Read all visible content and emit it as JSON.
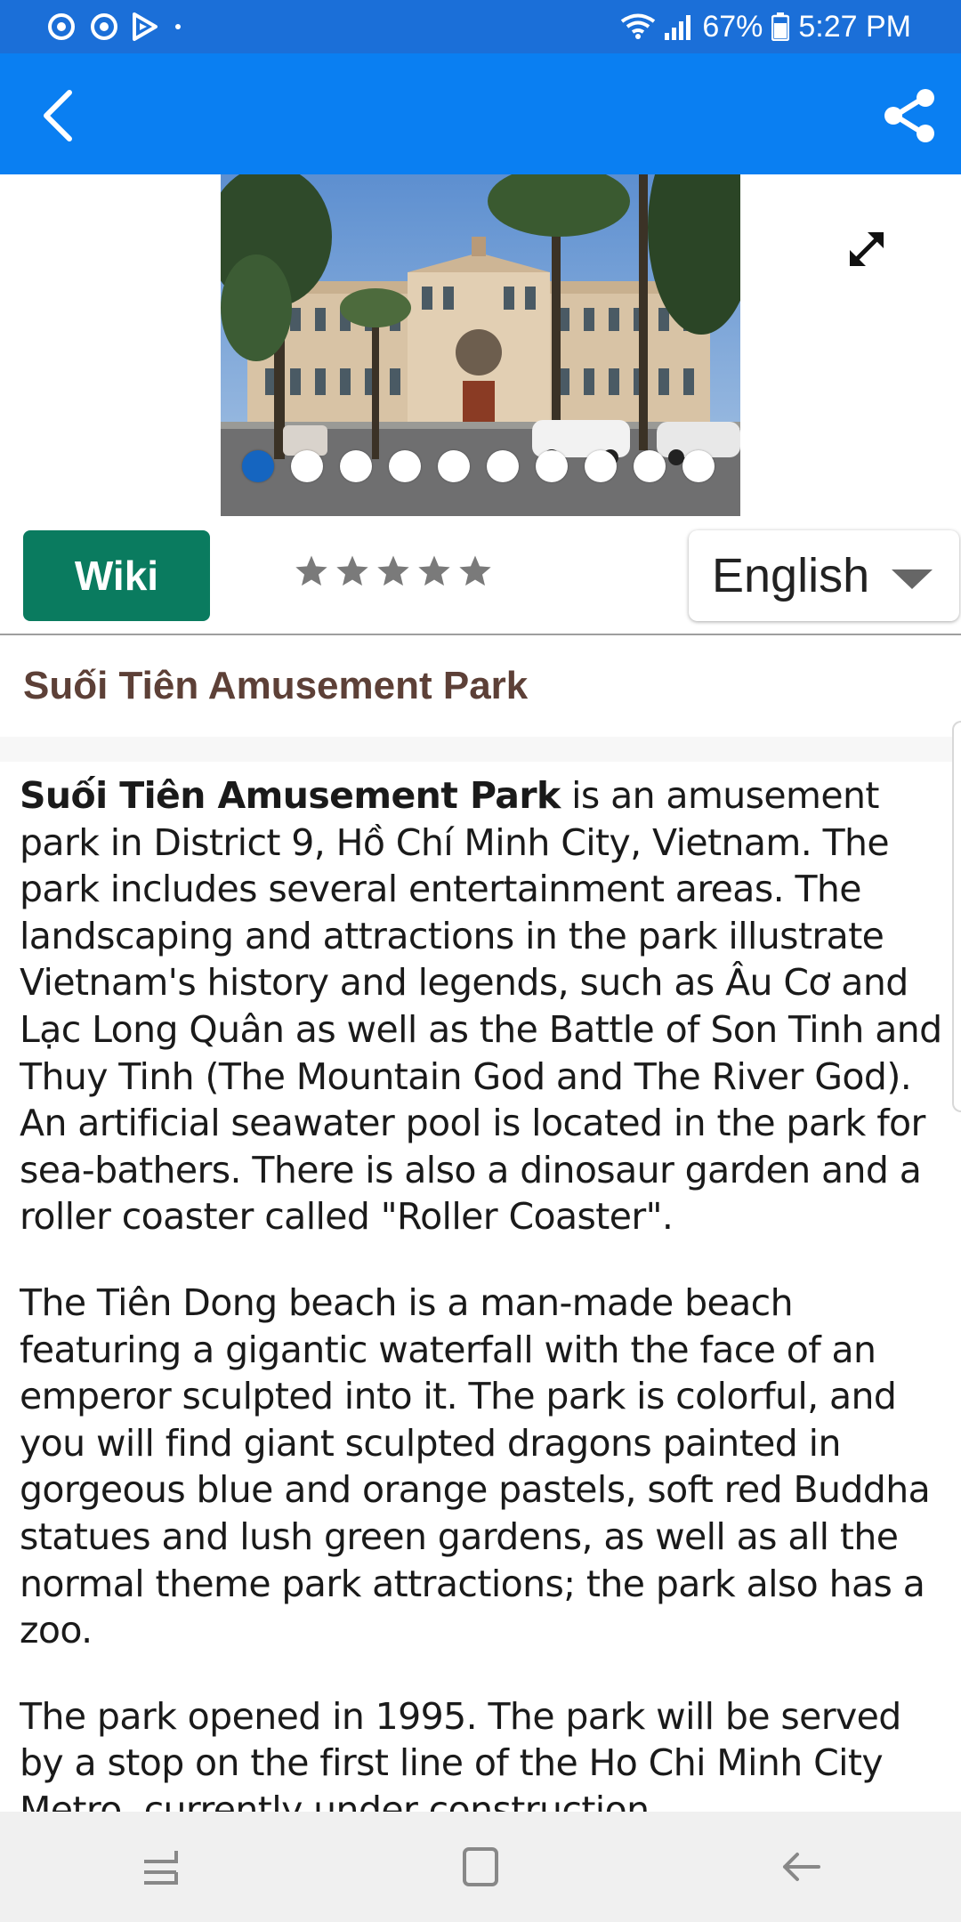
{
  "status_bar": {
    "battery": "67%",
    "time": "5:27 PM",
    "icons": [
      "notification-app-icon",
      "notification-app-icon",
      "play-store-icon",
      "dot-icon",
      "wifi-icon",
      "signal-icon",
      "battery-icon"
    ]
  },
  "app_bar": {
    "back_icon": "chevron-left-icon",
    "share_icon": "share-icon",
    "color": "#0a7ff2"
  },
  "gallery": {
    "image_alt": "Building with trees in front",
    "expand_icon": "expand-icon",
    "dot_count": 10,
    "active_index": 0
  },
  "toolbar": {
    "wiki_label": "Wiki",
    "wiki_color": "#0a7b5f",
    "rating": 0,
    "rating_max": 5,
    "language": "English"
  },
  "article": {
    "title": "Suối Tiên Amusement Park",
    "p1_bold": "Suối Tiên Amusement Park",
    "p1_rest": " is an amusement park in District 9, Hồ Chí Minh City, Vietnam. The park includes several entertainment areas. The landscaping and attractions in the park illustrate Vietnam's history and legends, such as Âu Cơ and Lạc Long Quân as well as the Battle of Son Tinh and Thuy Tinh (The Mountain God and The River God). An artificial seawater pool is located in the park for sea-bathers. There is also a dinosaur garden and a roller coaster called \"Roller Coaster\".",
    "p2": "The Tiên Dong beach is a man-made beach featuring a gigantic waterfall with the face of an emperor sculpted into it. The park is colorful, and you will find giant sculpted dragons painted in gorgeous blue and orange pastels, soft red Buddha statues and lush green gardens, as well as all the normal theme park attractions; the park also has a zoo.",
    "p3": "The park opened in 1995. The park will be served by a stop on the first line of the Ho Chi Minh City Metro, currently under construction."
  },
  "nav_bar": {
    "recents_icon": "recent-apps-icon",
    "home_icon": "home-icon",
    "back_icon": "back-arrow-icon"
  }
}
